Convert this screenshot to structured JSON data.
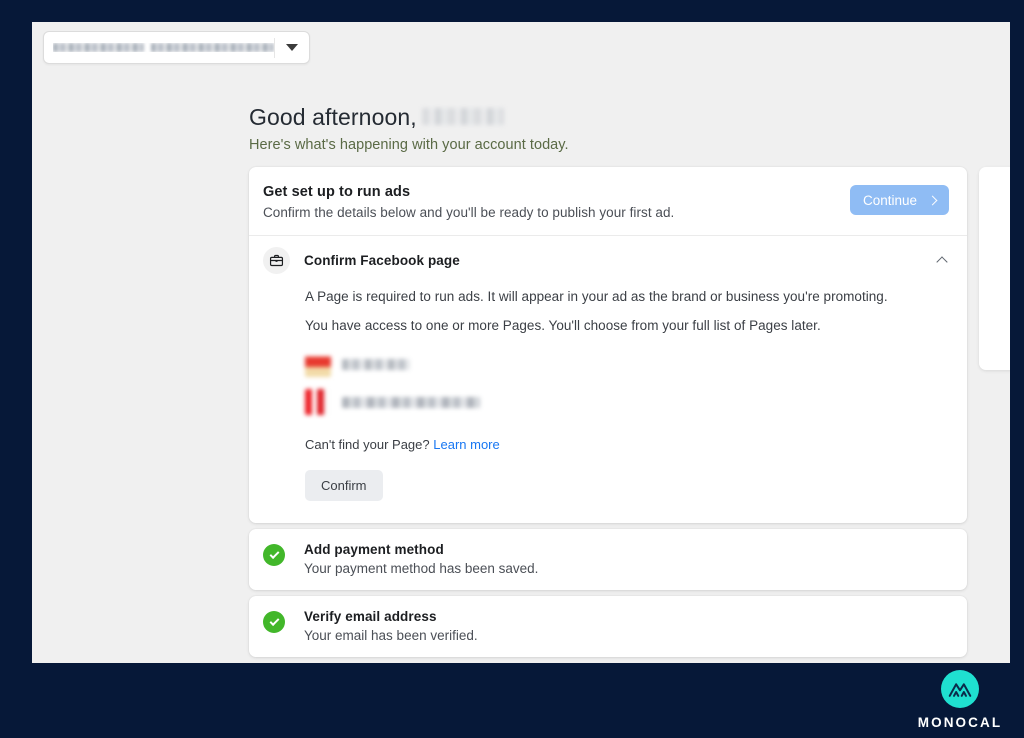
{
  "window": {
    "frame_color": "#061838",
    "page_background": "#f0f0f0"
  },
  "topbar": {
    "account_selector": {
      "name": "account-selector",
      "value_redacted": true,
      "caret_icon": "chevron-down-icon"
    }
  },
  "greeting": {
    "salutation": "Good afternoon,",
    "name_redacted": true,
    "subtitle": "Here's what's happening with your account today."
  },
  "setup_card": {
    "title": "Get set up to run ads",
    "subtitle": "Confirm the details below and you'll be ready to publish your first ad.",
    "continue_label": "Continue",
    "continue_icon": "chevron-right-icon",
    "continue_color": "#8fbcf4",
    "step": {
      "icon": "briefcase-icon",
      "label": "Confirm Facebook page",
      "collapse_icon": "chevron-up-icon",
      "expanded": true,
      "paragraphs": [
        "A Page is required to run ads. It will appear in your ad as the brand or business you're promoting.",
        "You have access to one or more Pages. You'll choose from your full list of Pages later."
      ],
      "pages": [
        {
          "name_redacted": true,
          "avatar_redacted": true
        },
        {
          "name_redacted": true,
          "avatar_redacted": true
        }
      ],
      "find_page_text": "Can't find your Page?",
      "find_page_link": "Learn more",
      "link_color": "#1877f2",
      "confirm_label": "Confirm"
    }
  },
  "completed_steps": [
    {
      "icon": "check-circle-icon",
      "title": "Add payment method",
      "subtitle": "Your payment method has been saved.",
      "status_color": "#42b72a"
    },
    {
      "icon": "check-circle-icon",
      "title": "Verify email address",
      "subtitle": "Your email has been verified.",
      "status_color": "#42b72a"
    }
  ],
  "branding": {
    "logo_icon": "monocal-mountain-icon",
    "wordmark": "MONOCAL",
    "accent_color": "#1fe0d0"
  }
}
